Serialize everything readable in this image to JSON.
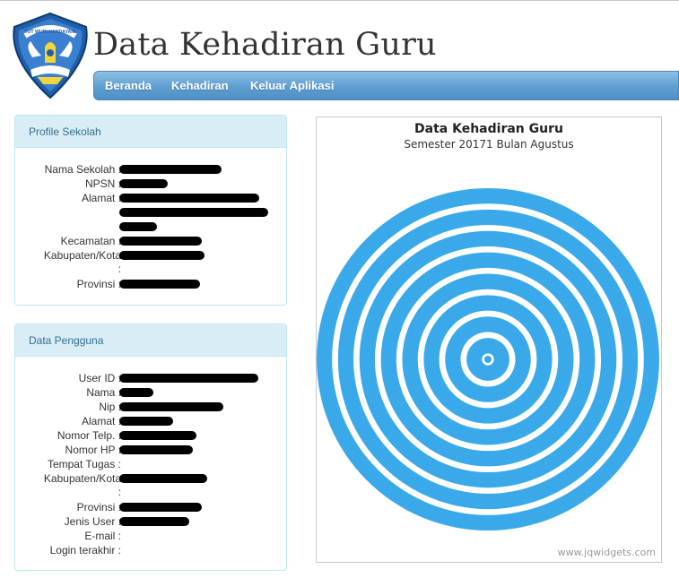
{
  "header": {
    "title": "Data Kehadiran Guru",
    "logo_motto": "TUT WURI HANDAYANI"
  },
  "nav": {
    "items": [
      {
        "label": "Beranda"
      },
      {
        "label": "Kehadiran"
      },
      {
        "label": "Keluar Aplikasi"
      }
    ]
  },
  "profile_sekolah": {
    "title": "Profile Sekolah",
    "fields": [
      {
        "label": "Nama Sekolah :"
      },
      {
        "label": "NPSN :"
      },
      {
        "label": "Alamat :"
      },
      {
        "label": "Kecamatan :"
      },
      {
        "label": "Kabupaten/Kota"
      },
      {
        "label": ":"
      },
      {
        "label": "Provinsi :"
      }
    ]
  },
  "data_pengguna": {
    "title": "Data Pengguna",
    "fields": [
      {
        "label": "User ID :"
      },
      {
        "label": "Nama :"
      },
      {
        "label": "Nip :"
      },
      {
        "label": "Alamat :"
      },
      {
        "label": "Nomor Telp. :"
      },
      {
        "label": "Nomor HP :"
      },
      {
        "label": "Tempat Tugas :"
      },
      {
        "label": "Kabupaten/Kota"
      },
      {
        "label": ":"
      },
      {
        "label": "Provinsi :"
      },
      {
        "label": "Jenis User :"
      },
      {
        "label": "E-mail :"
      },
      {
        "label": "Login terakhir :"
      }
    ]
  },
  "chart_data": {
    "type": "pie",
    "title": "Data Kehadiran Guru",
    "subtitle": "Semester 20171 Bulan Agustus",
    "watermark": "www.jqwidgets.com",
    "ring_count": 8,
    "colors": {
      "ring": "#3aa9ea",
      "ring_inner": "#5cc0f5",
      "background": "#ffffff"
    }
  },
  "colors": {
    "nav_gradient_top": "#8cc0e4",
    "nav_gradient_bottom": "#4d8fc6",
    "panel_header_bg": "#d9edf7",
    "panel_border": "#bce8f1",
    "panel_title_text": "#31708f"
  },
  "icons": {
    "logo": "tut-wuri-handayani-logo"
  }
}
